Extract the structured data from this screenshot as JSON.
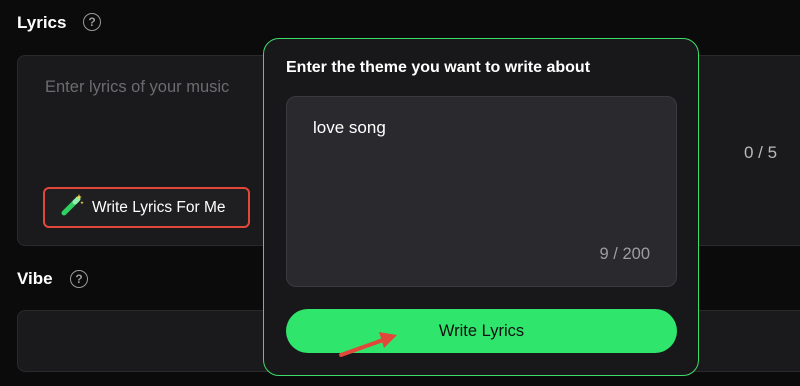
{
  "lyrics": {
    "label": "Lyrics",
    "help_icon": "question-circle-icon",
    "placeholder": "Enter lyrics of your music",
    "write_for_me_label": "Write Lyrics For Me",
    "write_for_me_icon": "magic-wand-icon",
    "char_count": "0 / 5"
  },
  "vibe": {
    "label": "Vibe",
    "help_icon": "question-circle-icon"
  },
  "popover": {
    "title": "Enter the theme you want to write about",
    "theme_value": "love song",
    "theme_counter": "9 / 200",
    "submit_label": "Write Lyrics"
  },
  "colors": {
    "background": "#0b0b0c",
    "accent_green": "#2fe56c",
    "highlight_red": "#e2483a",
    "annotation_arrow": "#e2483a"
  }
}
